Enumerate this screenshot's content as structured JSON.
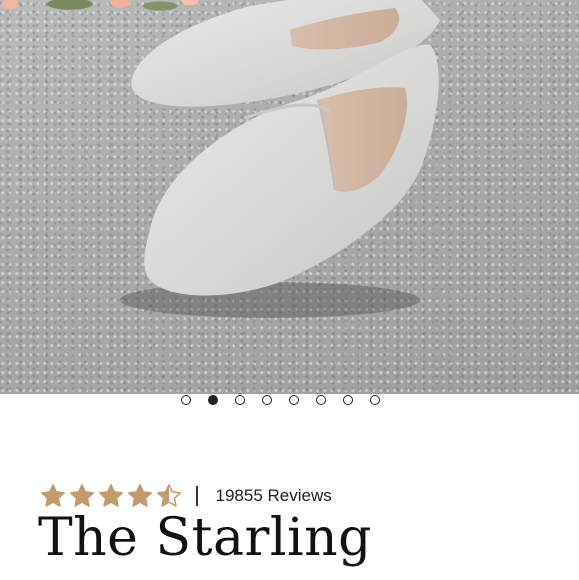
{
  "carousel": {
    "image_alt": "Light grey suede loafers on concrete",
    "slide_count": 8,
    "active_index": 1
  },
  "product": {
    "rating_value": 4.5,
    "rating_max": 5,
    "reviews_text": "19855 Reviews",
    "name": "The Starling"
  },
  "colors": {
    "star": "#c49a6c",
    "text": "#111111",
    "dot": "#222222"
  },
  "icons": {
    "star_full": "star-icon",
    "star_half": "star-half-icon"
  }
}
